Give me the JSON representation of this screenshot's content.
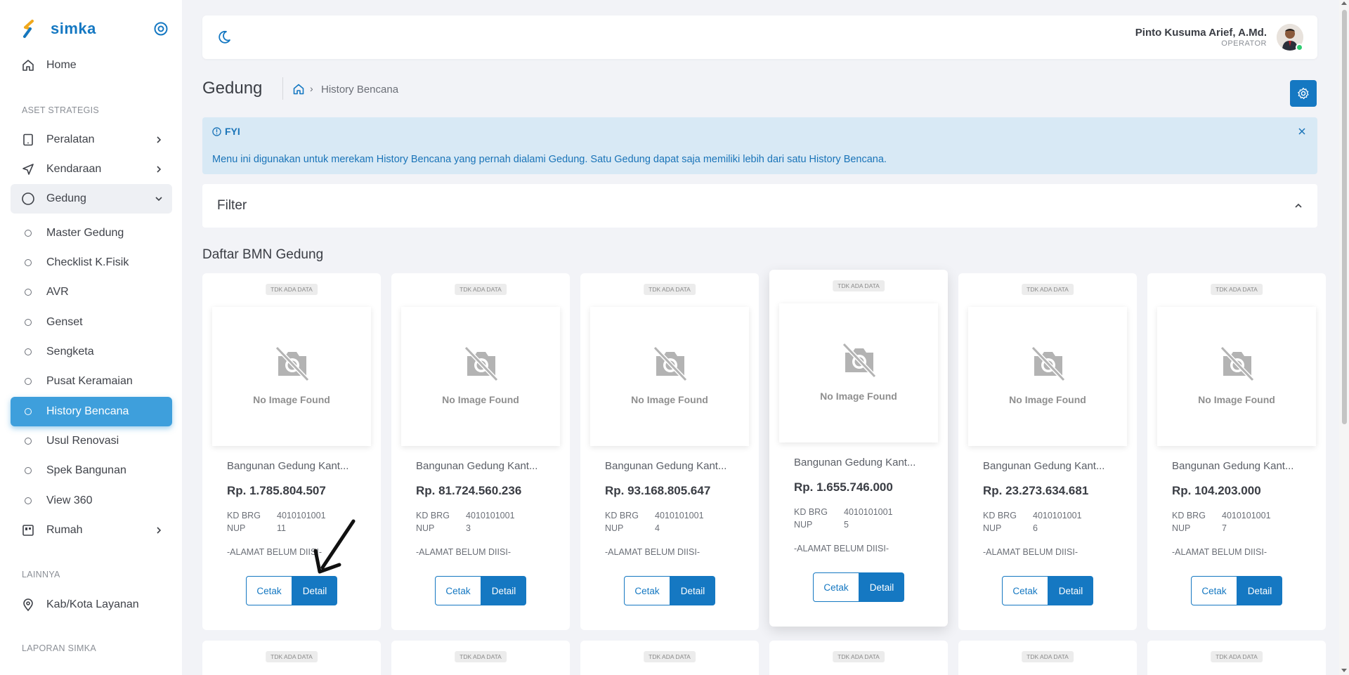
{
  "app": {
    "name": "simka"
  },
  "sidebar": {
    "home": "Home",
    "section_aset": "ASET STRATEGIS",
    "peralatan": "Peralatan",
    "kendaraan": "Kendaraan",
    "gedung": "Gedung",
    "sub": [
      "Master Gedung",
      "Checklist K.Fisik",
      "AVR",
      "Genset",
      "Sengketa",
      "Pusat Keramaian",
      "History Bencana",
      "Usul Renovasi",
      "Spek Bangunan",
      "View 360"
    ],
    "rumah": "Rumah",
    "section_lainnya": "LAINNYA",
    "kabkota": "Kab/Kota Layanan",
    "section_laporan": "LAPORAN SIMKA"
  },
  "user": {
    "name": "Pinto Kusuma Arief, A.Md.",
    "role": "OPERATOR"
  },
  "page": {
    "title": "Gedung",
    "breadcrumb_current": "History Bencana"
  },
  "alert": {
    "title": "FYI",
    "text": "Menu ini digunakan untuk merekam History Bencana yang pernah dialami Gedung. Satu Gedung dapat saja memiliki lebih dari satu History Bencana."
  },
  "filter": {
    "title": "Filter"
  },
  "list": {
    "title": "Daftar BMN Gedung"
  },
  "card_labels": {
    "badge": "TDK ADA DATA",
    "no_image": "No Image Found",
    "kd_brg": "KD BRG",
    "nup": "NUP",
    "cetak": "Cetak",
    "detail": "Detail"
  },
  "cards": [
    {
      "name": "Bangunan Gedung Kant...",
      "price": "Rp. 1.785.804.507",
      "kd_brg": "4010101001",
      "nup": "11",
      "address": "-ALAMAT BELUM DIISI-"
    },
    {
      "name": "Bangunan Gedung Kant...",
      "price": "Rp. 81.724.560.236",
      "kd_brg": "4010101001",
      "nup": "3",
      "address": "-ALAMAT BELUM DIISI-"
    },
    {
      "name": "Bangunan Gedung Kant...",
      "price": "Rp. 93.168.805.647",
      "kd_brg": "4010101001",
      "nup": "4",
      "address": "-ALAMAT BELUM DIISI-"
    },
    {
      "name": "Bangunan Gedung Kant...",
      "price": "Rp. 1.655.746.000",
      "kd_brg": "4010101001",
      "nup": "5",
      "address": "-ALAMAT BELUM DIISI-"
    },
    {
      "name": "Bangunan Gedung Kant...",
      "price": "Rp. 23.273.634.681",
      "kd_brg": "4010101001",
      "nup": "6",
      "address": "-ALAMAT BELUM DIISI-"
    },
    {
      "name": "Bangunan Gedung Kant...",
      "price": "Rp. 104.203.000",
      "kd_brg": "4010101001",
      "nup": "7",
      "address": "-ALAMAT BELUM DIISI-"
    }
  ],
  "colors": {
    "primary": "#1578c2",
    "active_nav": "#3e9fdc",
    "alert_bg": "#d8e9f5"
  },
  "icons": {
    "brand": "simka-logo",
    "toggle": "target-icon",
    "theme": "moon-icon",
    "settings": "gear-icon",
    "no_image": "camera-off-icon"
  }
}
